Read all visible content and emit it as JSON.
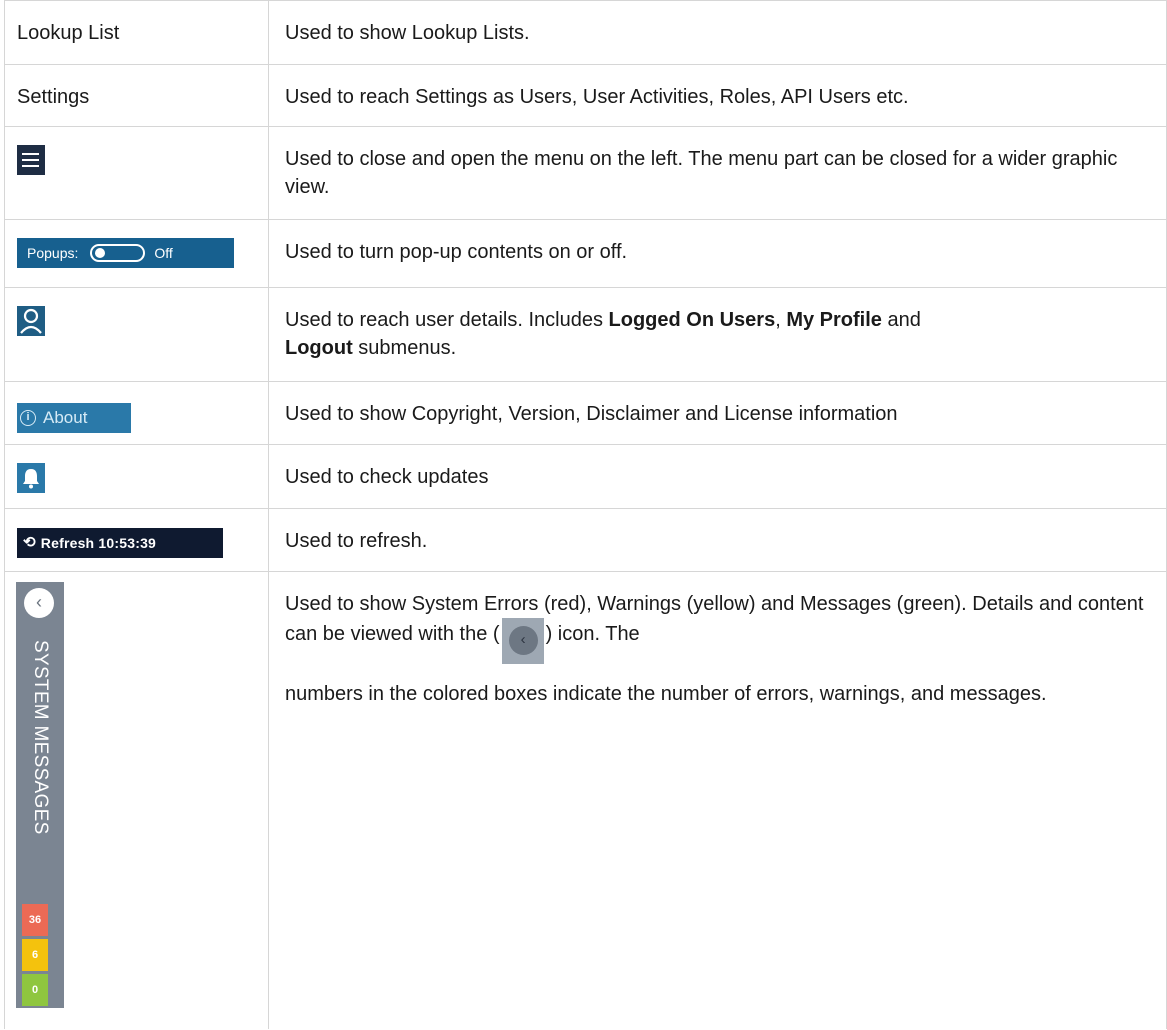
{
  "rows": {
    "lookup": {
      "label": "Lookup List",
      "description": "Used to show Lookup Lists."
    },
    "settings": {
      "label": "Settings",
      "description": "Used to reach Settings as Users, User Activities, Roles, API Users etc."
    },
    "menu": {
      "icon": "hamburger-menu-icon",
      "description": "Used to close and open the menu on the left. The menu part can be closed for a wider graphic view."
    },
    "popups": {
      "label": "Popups:",
      "state": "Off",
      "description": "Used to turn pop-up contents on or off."
    },
    "user": {
      "icon": "user-icon",
      "desc_a": "Used to reach user details. Includes ",
      "b1": "Logged On Users",
      "desc_b": ", ",
      "b2": "My Profile",
      "desc_c": " and ",
      "b3": "Logout",
      "desc_d": " submenus."
    },
    "about": {
      "icon_glyph": "i",
      "label": "About",
      "description": "Used to show Copyright, Version, Disclaimer and License information"
    },
    "updates": {
      "icon": "bell-icon",
      "description": "Used to check updates"
    },
    "refresh": {
      "icon_glyph": "⟲",
      "label": "Refresh 10:53:39",
      "description": "Used to refresh."
    },
    "system_messages": {
      "collapse_glyph": "‹",
      "title": "SYSTEM MESSAGES",
      "counts": {
        "errors": "36",
        "warnings": "6",
        "messages": "0"
      },
      "colors": {
        "errors": "#ec6a55",
        "warnings": "#f4c20d",
        "messages": "#8fc63f"
      },
      "desc_a": "Used to show System Errors (red), Warnings (yellow) and Messages (green). Details and content can be viewed with the (",
      "chevron_glyph": "‹",
      "desc_b": ") icon. The",
      "desc_c": "numbers in the colored boxes indicate the number of errors, warnings, and messages."
    }
  }
}
